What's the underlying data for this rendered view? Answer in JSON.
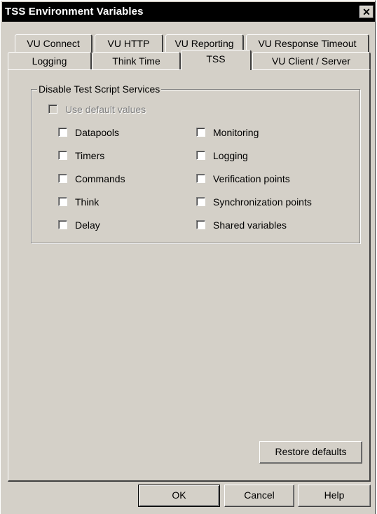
{
  "window": {
    "title": "TSS Environment Variables",
    "close_glyph": "✕",
    "close_icon": "close-icon"
  },
  "tabs": {
    "row1": [
      "VU Connect",
      "VU HTTP",
      "VU Reporting",
      "VU Response Timeout"
    ],
    "row2": [
      "Logging",
      "Think Time",
      "TSS",
      "VU Client / Server"
    ],
    "active": "TSS"
  },
  "group": {
    "legend": "Disable Test Script Services",
    "use_default": {
      "label": "Use default values",
      "checked": false,
      "disabled": true
    },
    "left_options": [
      {
        "label": "Datapools",
        "checked": false
      },
      {
        "label": "Timers",
        "checked": false
      },
      {
        "label": "Commands",
        "checked": false
      },
      {
        "label": "Think",
        "checked": false
      },
      {
        "label": "Delay",
        "checked": false
      }
    ],
    "right_options": [
      {
        "label": "Monitoring",
        "checked": false
      },
      {
        "label": "Logging",
        "checked": false
      },
      {
        "label": "Verification points",
        "checked": false
      },
      {
        "label": "Synchronization points",
        "checked": false
      },
      {
        "label": "Shared variables",
        "checked": false
      }
    ]
  },
  "restore_button": "Restore defaults",
  "footer": {
    "ok": "OK",
    "cancel": "Cancel",
    "help": "Help"
  }
}
